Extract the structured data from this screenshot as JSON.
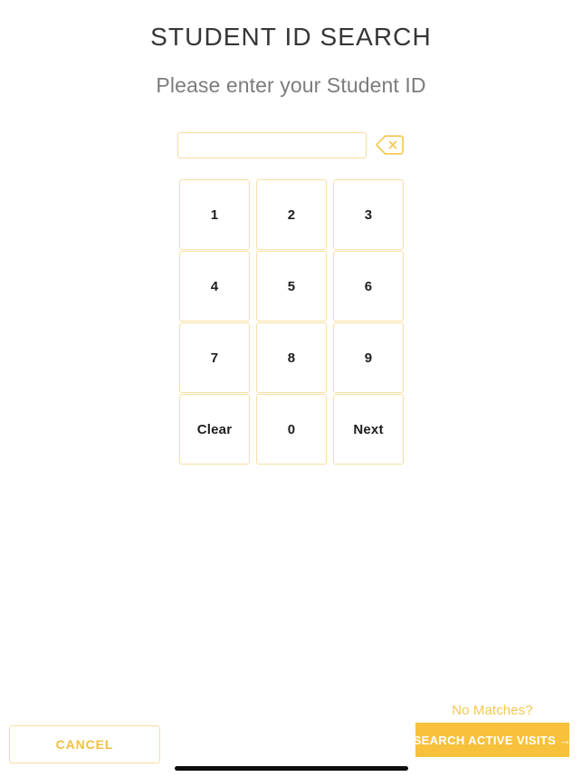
{
  "header": {
    "title": "STUDENT ID SEARCH",
    "subtitle": "Please enter your Student ID"
  },
  "entry": {
    "input_value": "",
    "input_placeholder": "",
    "backspace_icon": "backspace-delete-icon"
  },
  "keypad": {
    "keys": [
      {
        "label": "1",
        "name": "key-1"
      },
      {
        "label": "2",
        "name": "key-2"
      },
      {
        "label": "3",
        "name": "key-3"
      },
      {
        "label": "4",
        "name": "key-4"
      },
      {
        "label": "5",
        "name": "key-5"
      },
      {
        "label": "6",
        "name": "key-6"
      },
      {
        "label": "7",
        "name": "key-7"
      },
      {
        "label": "8",
        "name": "key-8"
      },
      {
        "label": "9",
        "name": "key-9"
      },
      {
        "label": "Clear",
        "name": "key-clear"
      },
      {
        "label": "0",
        "name": "key-0"
      },
      {
        "label": "Next",
        "name": "key-next"
      }
    ]
  },
  "footer": {
    "no_matches_label": "No Matches?",
    "cancel_label": "CANCEL",
    "search_active_visits_label": "SEARCH ACTIVE VISITS →"
  },
  "colors": {
    "accent_gold": "#f7c13c",
    "border_gold": "#f7dfa3",
    "title_gray": "#363636",
    "subtitle_gray": "#7c7c7c",
    "no_matches_gold": "#f6c751",
    "home_indicator": "#0d0d0d"
  }
}
